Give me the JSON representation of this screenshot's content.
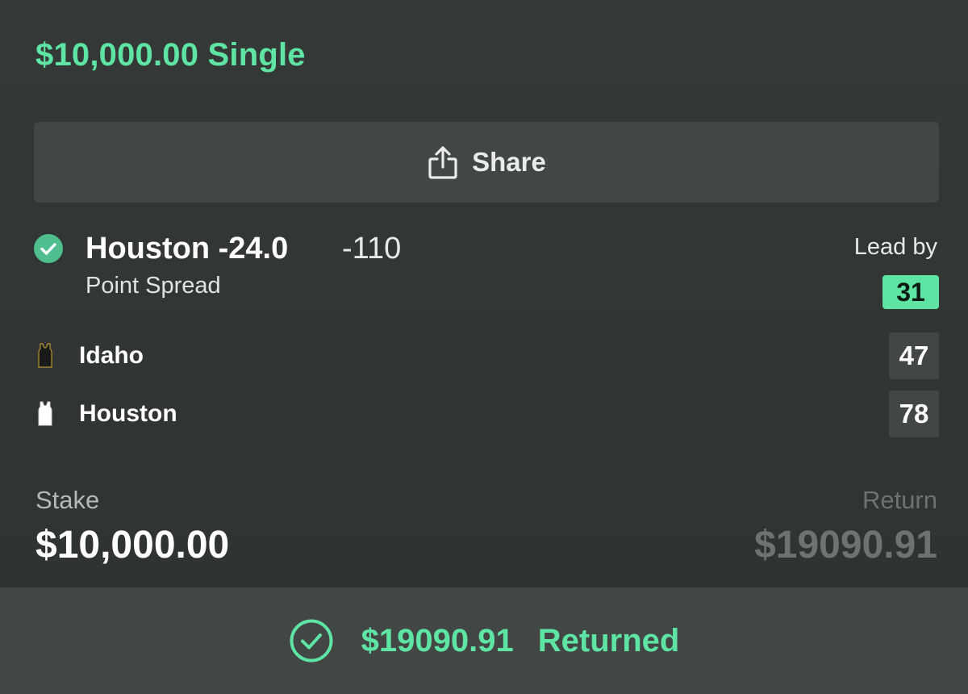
{
  "bet": {
    "title": "$10,000.00 Single"
  },
  "share": {
    "label": "Share",
    "icon": "share-icon"
  },
  "selection": {
    "status_icon": "check-circle-icon",
    "status_color": "#4fbf8f",
    "name": "Houston -24.0",
    "odds": "-110",
    "market": "Point Spread",
    "lead_label": "Lead by",
    "lead_value": "31"
  },
  "teams": [
    {
      "name": "Idaho",
      "score": "47",
      "jersey_icon": "jersey-icon",
      "jersey_color": "#1a1a1a"
    },
    {
      "name": "Houston",
      "score": "78",
      "jersey_icon": "jersey-icon",
      "jersey_color": "#ffffff"
    }
  ],
  "stake": {
    "label": "Stake",
    "value": "$10,000.00"
  },
  "return": {
    "label": "Return",
    "value": "$19090.91"
  },
  "footer": {
    "icon": "check-circle-outline-icon",
    "amount": "$19090.91",
    "status": "Returned"
  },
  "colors": {
    "accent": "#5ee5a3",
    "background": "#323635",
    "surface": "#424645"
  }
}
